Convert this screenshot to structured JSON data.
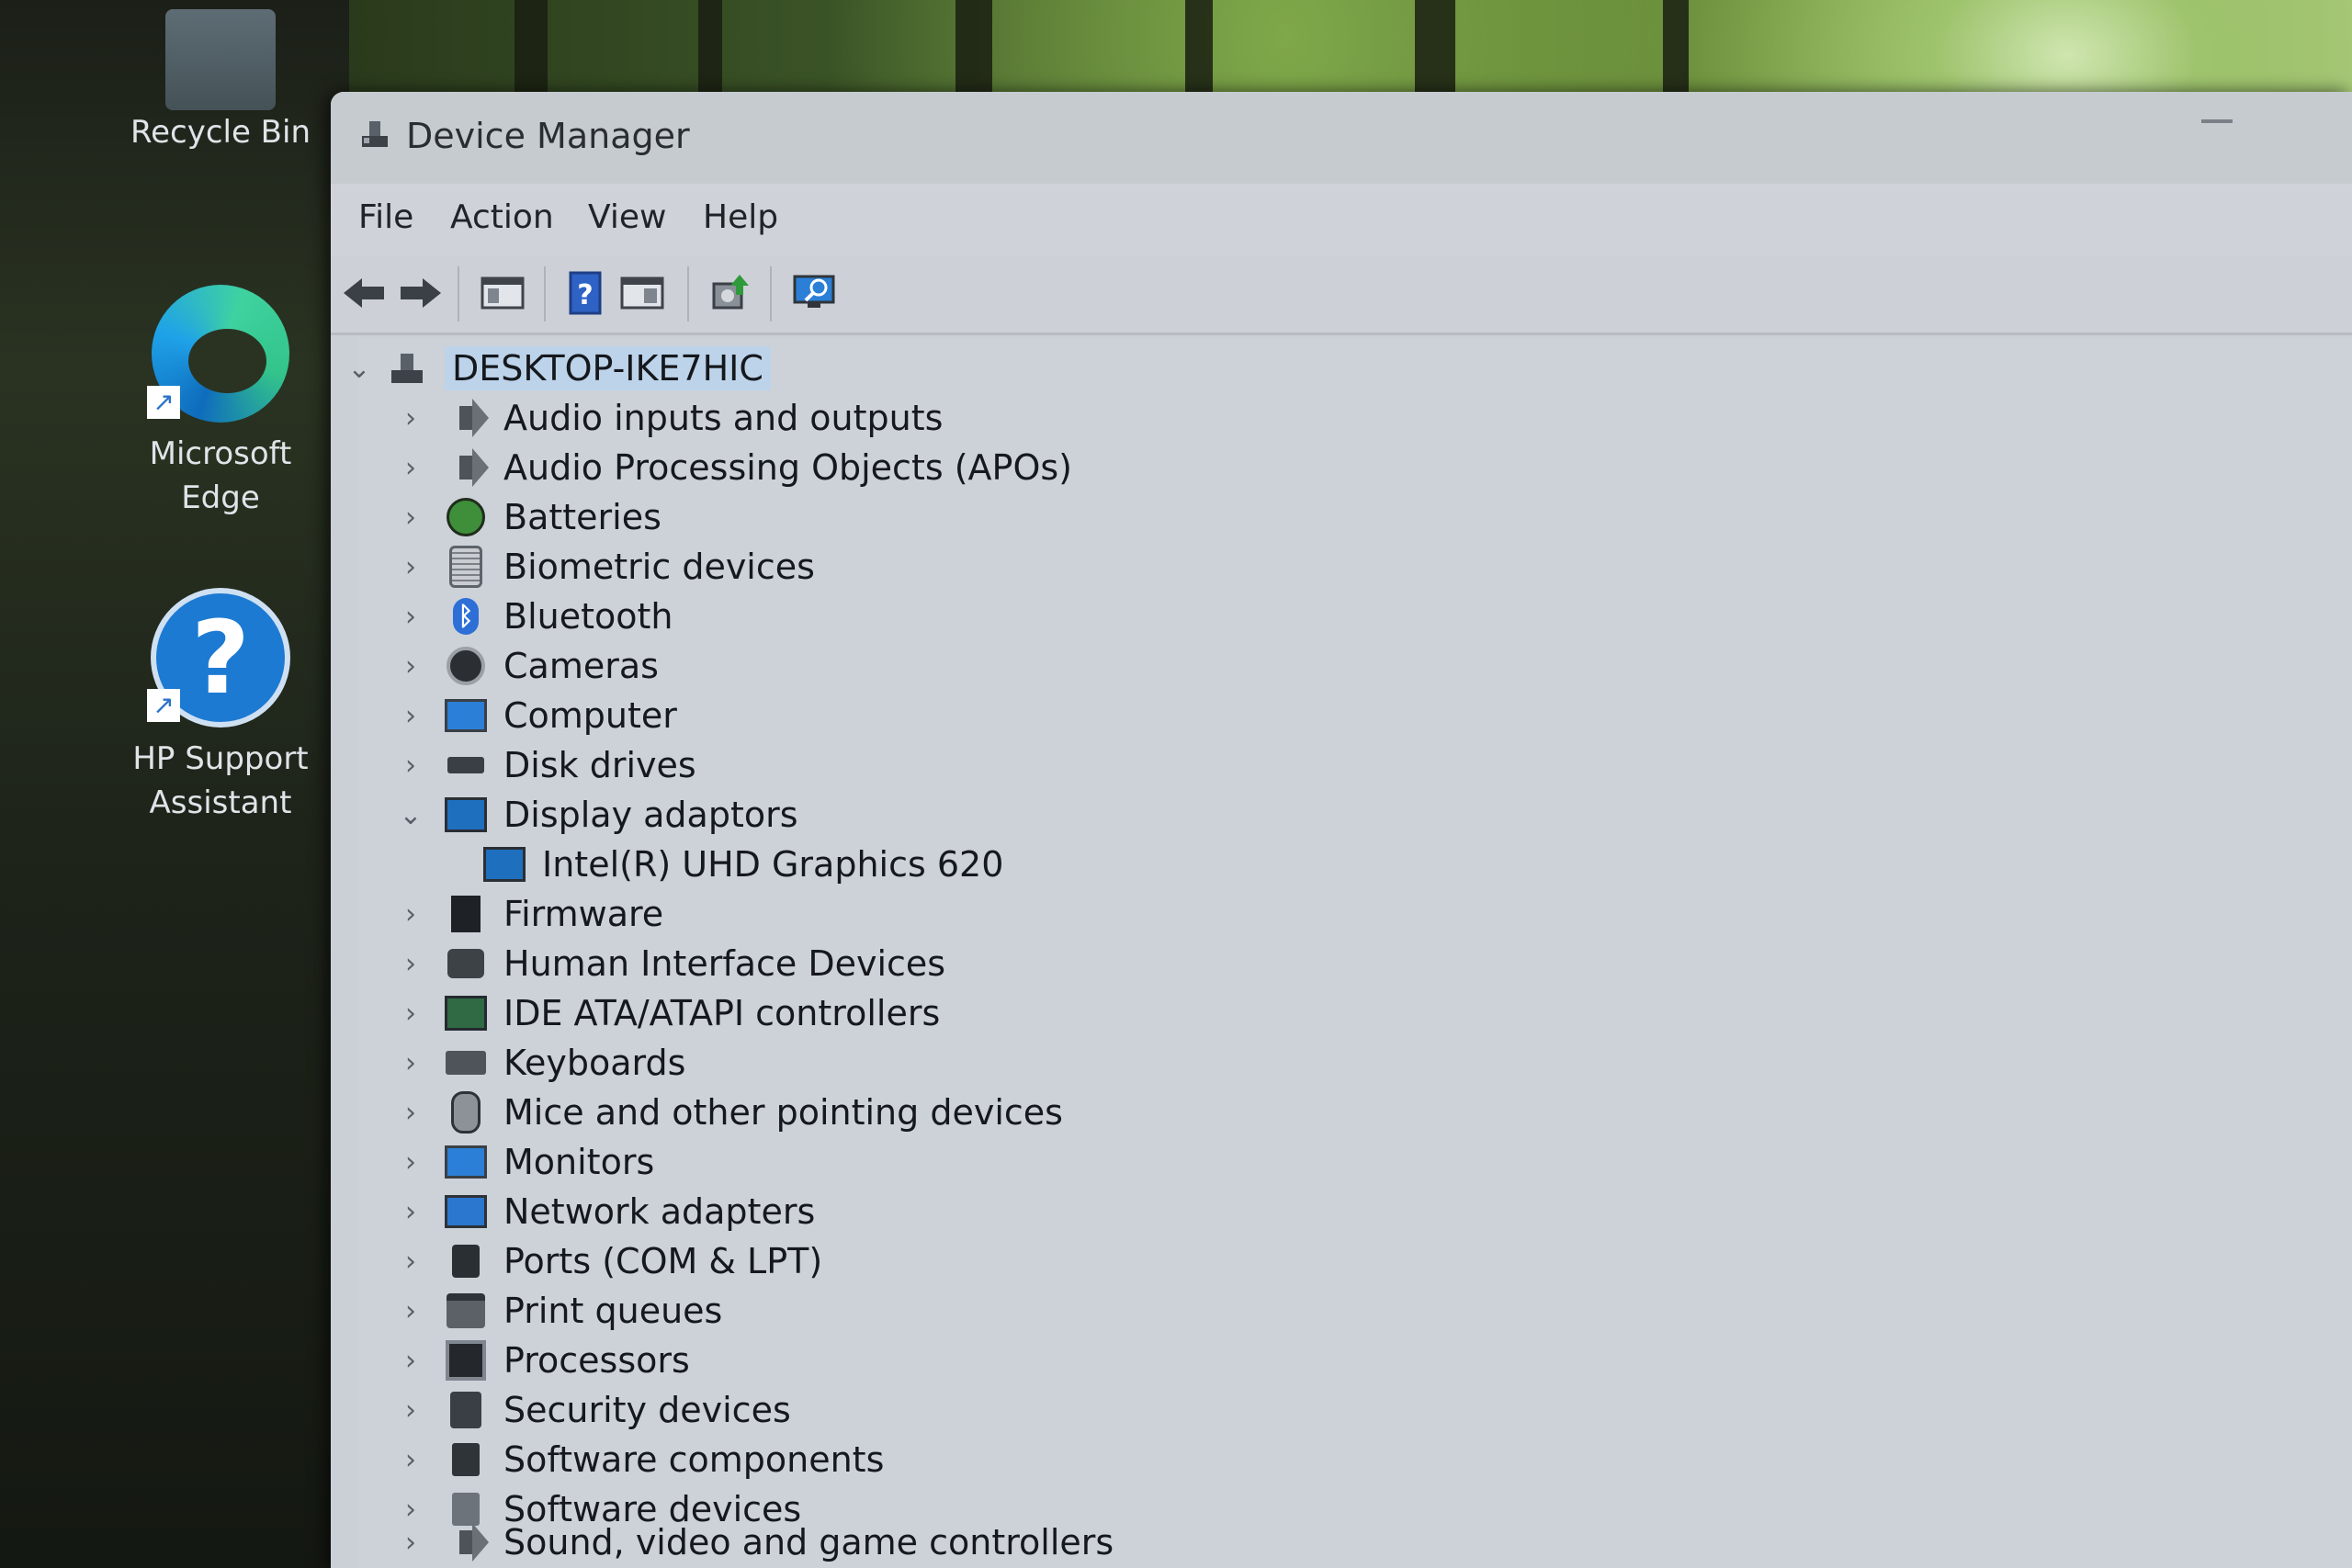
{
  "desktop": {
    "icons": [
      {
        "label": "Recycle Bin"
      },
      {
        "label": "Microsoft Edge"
      },
      {
        "label": "HP Support Assistant"
      }
    ]
  },
  "window": {
    "title": "Device Manager",
    "menu": [
      "File",
      "Action",
      "View",
      "Help"
    ],
    "toolbar": [
      {
        "icon": "back-arrow-icon"
      },
      {
        "icon": "forward-arrow-icon"
      },
      {
        "icon": "show-hide-console-tree-icon"
      },
      {
        "icon": "help-icon"
      },
      {
        "icon": "properties-pane-icon"
      },
      {
        "icon": "update-driver-icon"
      },
      {
        "icon": "scan-hardware-changes-icon"
      }
    ]
  },
  "tree": {
    "root": "DESKTOP-IKE7HIC",
    "items": [
      {
        "label": "Audio inputs and outputs",
        "icon": "speaker-icon",
        "expanded": false
      },
      {
        "label": "Audio Processing Objects (APOs)",
        "icon": "speaker-icon",
        "expanded": false
      },
      {
        "label": "Batteries",
        "icon": "battery-icon",
        "expanded": false
      },
      {
        "label": "Biometric devices",
        "icon": "fingerprint-icon",
        "expanded": false
      },
      {
        "label": "Bluetooth",
        "icon": "bluetooth-icon",
        "expanded": false
      },
      {
        "label": "Cameras",
        "icon": "camera-icon",
        "expanded": false
      },
      {
        "label": "Computer",
        "icon": "computer-icon",
        "expanded": false
      },
      {
        "label": "Disk drives",
        "icon": "disk-drive-icon",
        "expanded": false
      },
      {
        "label": "Display adaptors",
        "icon": "display-adapter-icon",
        "expanded": true,
        "children": [
          "Intel(R) UHD Graphics 620"
        ]
      },
      {
        "label": "Firmware",
        "icon": "firmware-icon",
        "expanded": false
      },
      {
        "label": "Human Interface Devices",
        "icon": "hid-icon",
        "expanded": false
      },
      {
        "label": "IDE ATA/ATAPI controllers",
        "icon": "ide-controller-icon",
        "expanded": false
      },
      {
        "label": "Keyboards",
        "icon": "keyboard-icon",
        "expanded": false
      },
      {
        "label": "Mice and other pointing devices",
        "icon": "mouse-icon",
        "expanded": false
      },
      {
        "label": "Monitors",
        "icon": "monitor-icon",
        "expanded": false
      },
      {
        "label": "Network adapters",
        "icon": "network-adapter-icon",
        "expanded": false
      },
      {
        "label": "Ports (COM & LPT)",
        "icon": "port-icon",
        "expanded": false
      },
      {
        "label": "Print queues",
        "icon": "printer-icon",
        "expanded": false
      },
      {
        "label": "Processors",
        "icon": "processor-icon",
        "expanded": false
      },
      {
        "label": "Security devices",
        "icon": "security-device-icon",
        "expanded": false
      },
      {
        "label": "Software components",
        "icon": "software-component-icon",
        "expanded": false
      },
      {
        "label": "Software devices",
        "icon": "software-device-icon",
        "expanded": false
      },
      {
        "label": "Sound, video and game controllers",
        "icon": "speaker-icon",
        "expanded": false
      }
    ]
  }
}
